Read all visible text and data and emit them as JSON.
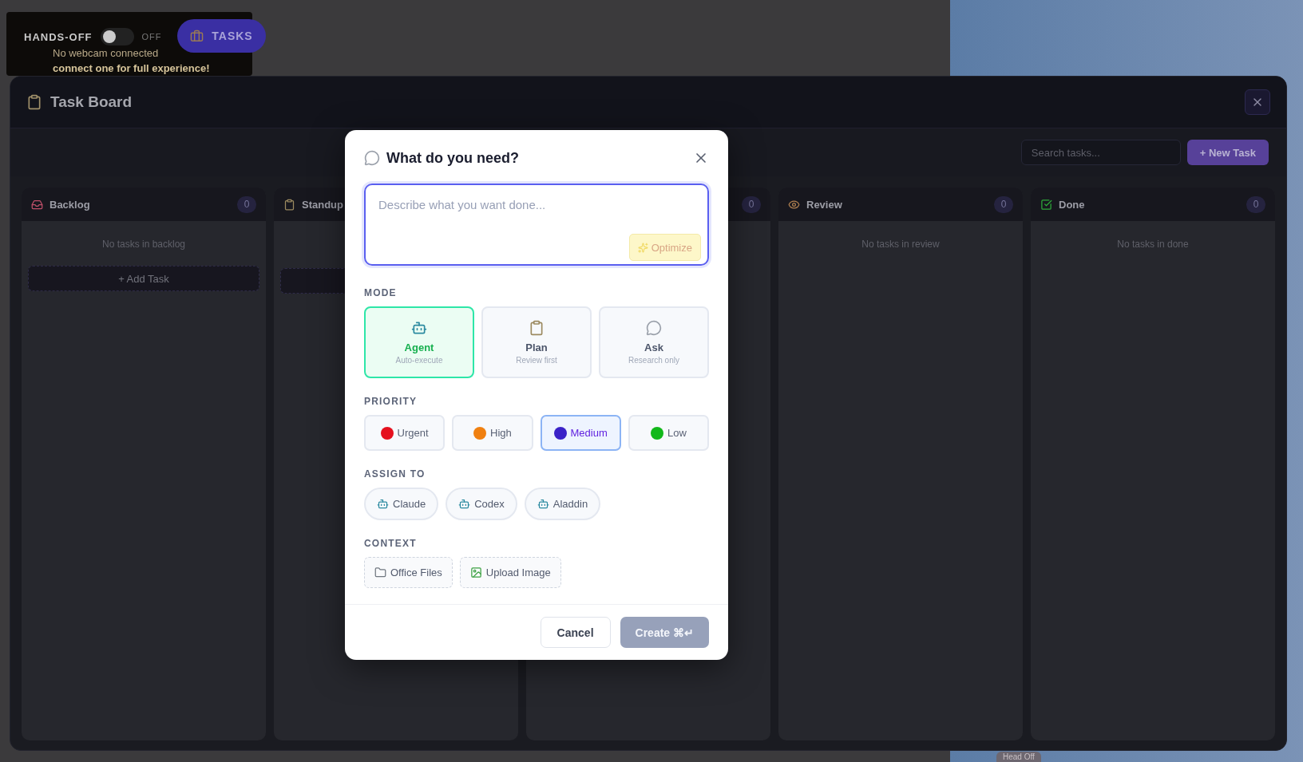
{
  "hud": {
    "hands_off": {
      "label": "HANDS-OFF",
      "on": false,
      "state_text": "OFF"
    },
    "tasks_button": "TASKS",
    "webcam_notice": "No webcam connected",
    "webcam_hint": "connect one for full experience!"
  },
  "board": {
    "title": "Task Board",
    "search": {
      "placeholder": "Search tasks..."
    },
    "new_task_button": "+ New Task",
    "columns": [
      {
        "title": "Backlog",
        "count": "0",
        "empty_text": "No tasks in backlog",
        "add_task_shown": true,
        "add_task": "+ Add Task"
      },
      {
        "title": "Standup",
        "add_task_shown": true
      },
      {
        "count": "0"
      },
      {
        "title": "Review",
        "count": "0",
        "empty_text": "No tasks in review"
      },
      {
        "title": "Done",
        "count": "0",
        "empty_text": "No tasks in done"
      }
    ]
  },
  "dialog": {
    "title": "What do you need?",
    "prompt": {
      "placeholder": "Describe what you want done..."
    },
    "optimize_button": "Optimize",
    "mode": {
      "label": "MODE",
      "options": [
        {
          "name": "Agent",
          "hint": "Auto-execute",
          "selected": true
        },
        {
          "name": "Plan",
          "hint": "Review first",
          "selected": false
        },
        {
          "name": "Ask",
          "hint": "Research only",
          "selected": false
        }
      ]
    },
    "priority": {
      "label": "PRIORITY",
      "options": [
        {
          "name": "Urgent",
          "color": "#e5101e",
          "selected": false
        },
        {
          "name": "High",
          "color": "#f08010",
          "selected": false
        },
        {
          "name": "Medium",
          "color": "#3a22c8",
          "selected": true
        },
        {
          "name": "Low",
          "color": "#12b81a",
          "selected": false
        }
      ]
    },
    "assign": {
      "label": "ASSIGN TO",
      "agents": [
        {
          "name": "Claude",
          "selected": false
        },
        {
          "name": "Codex",
          "selected": false
        },
        {
          "name": "Aladdin",
          "selected": false
        }
      ]
    },
    "context": {
      "label": "CONTEXT",
      "buttons": [
        "Office Files",
        "Upload Image"
      ]
    },
    "cancel_button": "Cancel",
    "create_button": {
      "label": "Create ⌘↵",
      "disabled": true
    }
  },
  "bottom_bar": {
    "label": "Head Off"
  }
}
